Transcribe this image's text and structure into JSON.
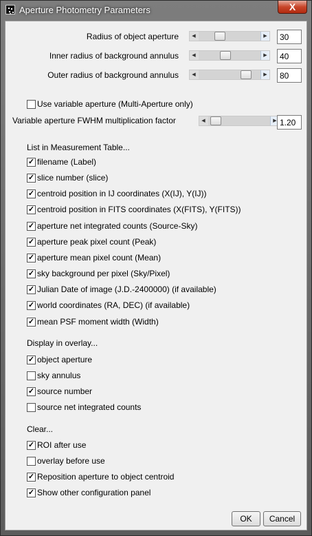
{
  "window": {
    "title": "Aperture Photometry Parameters",
    "close_label": "X"
  },
  "apertures": [
    {
      "label": "Radius of object aperture",
      "value": "30"
    },
    {
      "label": "Inner radius of background annulus",
      "value": "40"
    },
    {
      "label": "Outer radius of background annulus",
      "value": "80"
    }
  ],
  "variable_aperture": {
    "label": "Use variable aperture (Multi-Aperture only)",
    "checked": false
  },
  "fwhm": {
    "label": "Variable aperture FWHM multiplication factor",
    "value": "1.20"
  },
  "measurement": {
    "heading": "List in Measurement Table...",
    "items": [
      {
        "label": "filename (Label)",
        "checked": true
      },
      {
        "label": "slice number (slice)",
        "checked": true
      },
      {
        "label": "centroid position in IJ coordinates (X(IJ), Y(IJ))",
        "checked": true
      },
      {
        "label": "centroid position in FITS coordinates (X(FITS), Y(FITS))",
        "checked": true
      },
      {
        "label": "aperture net integrated counts (Source-Sky)",
        "checked": true
      },
      {
        "label": "aperture peak pixel count (Peak)",
        "checked": true
      },
      {
        "label": "aperture mean pixel count (Mean)",
        "checked": true
      },
      {
        "label": "sky background per pixel (Sky/Pixel)",
        "checked": true
      },
      {
        "label": "Julian Date of image (J.D.-2400000) (if available)",
        "checked": true
      },
      {
        "label": "world coordinates (RA, DEC) (if available)",
        "checked": true
      },
      {
        "label": "mean PSF moment width (Width)",
        "checked": true
      }
    ]
  },
  "overlay": {
    "heading": "Display in overlay...",
    "items": [
      {
        "label": "object aperture",
        "checked": true
      },
      {
        "label": "sky annulus",
        "checked": false
      },
      {
        "label": "source number",
        "checked": true
      },
      {
        "label": "source net integrated counts",
        "checked": false
      }
    ]
  },
  "clear": {
    "heading": "Clear...",
    "items": [
      {
        "label": "ROI after use",
        "checked": true
      },
      {
        "label": "overlay before use",
        "checked": false
      },
      {
        "label": "Reposition aperture to object centroid",
        "checked": true
      },
      {
        "label": "Show other configuration panel",
        "checked": true
      }
    ]
  },
  "buttons": {
    "ok": "OK",
    "cancel": "Cancel"
  }
}
